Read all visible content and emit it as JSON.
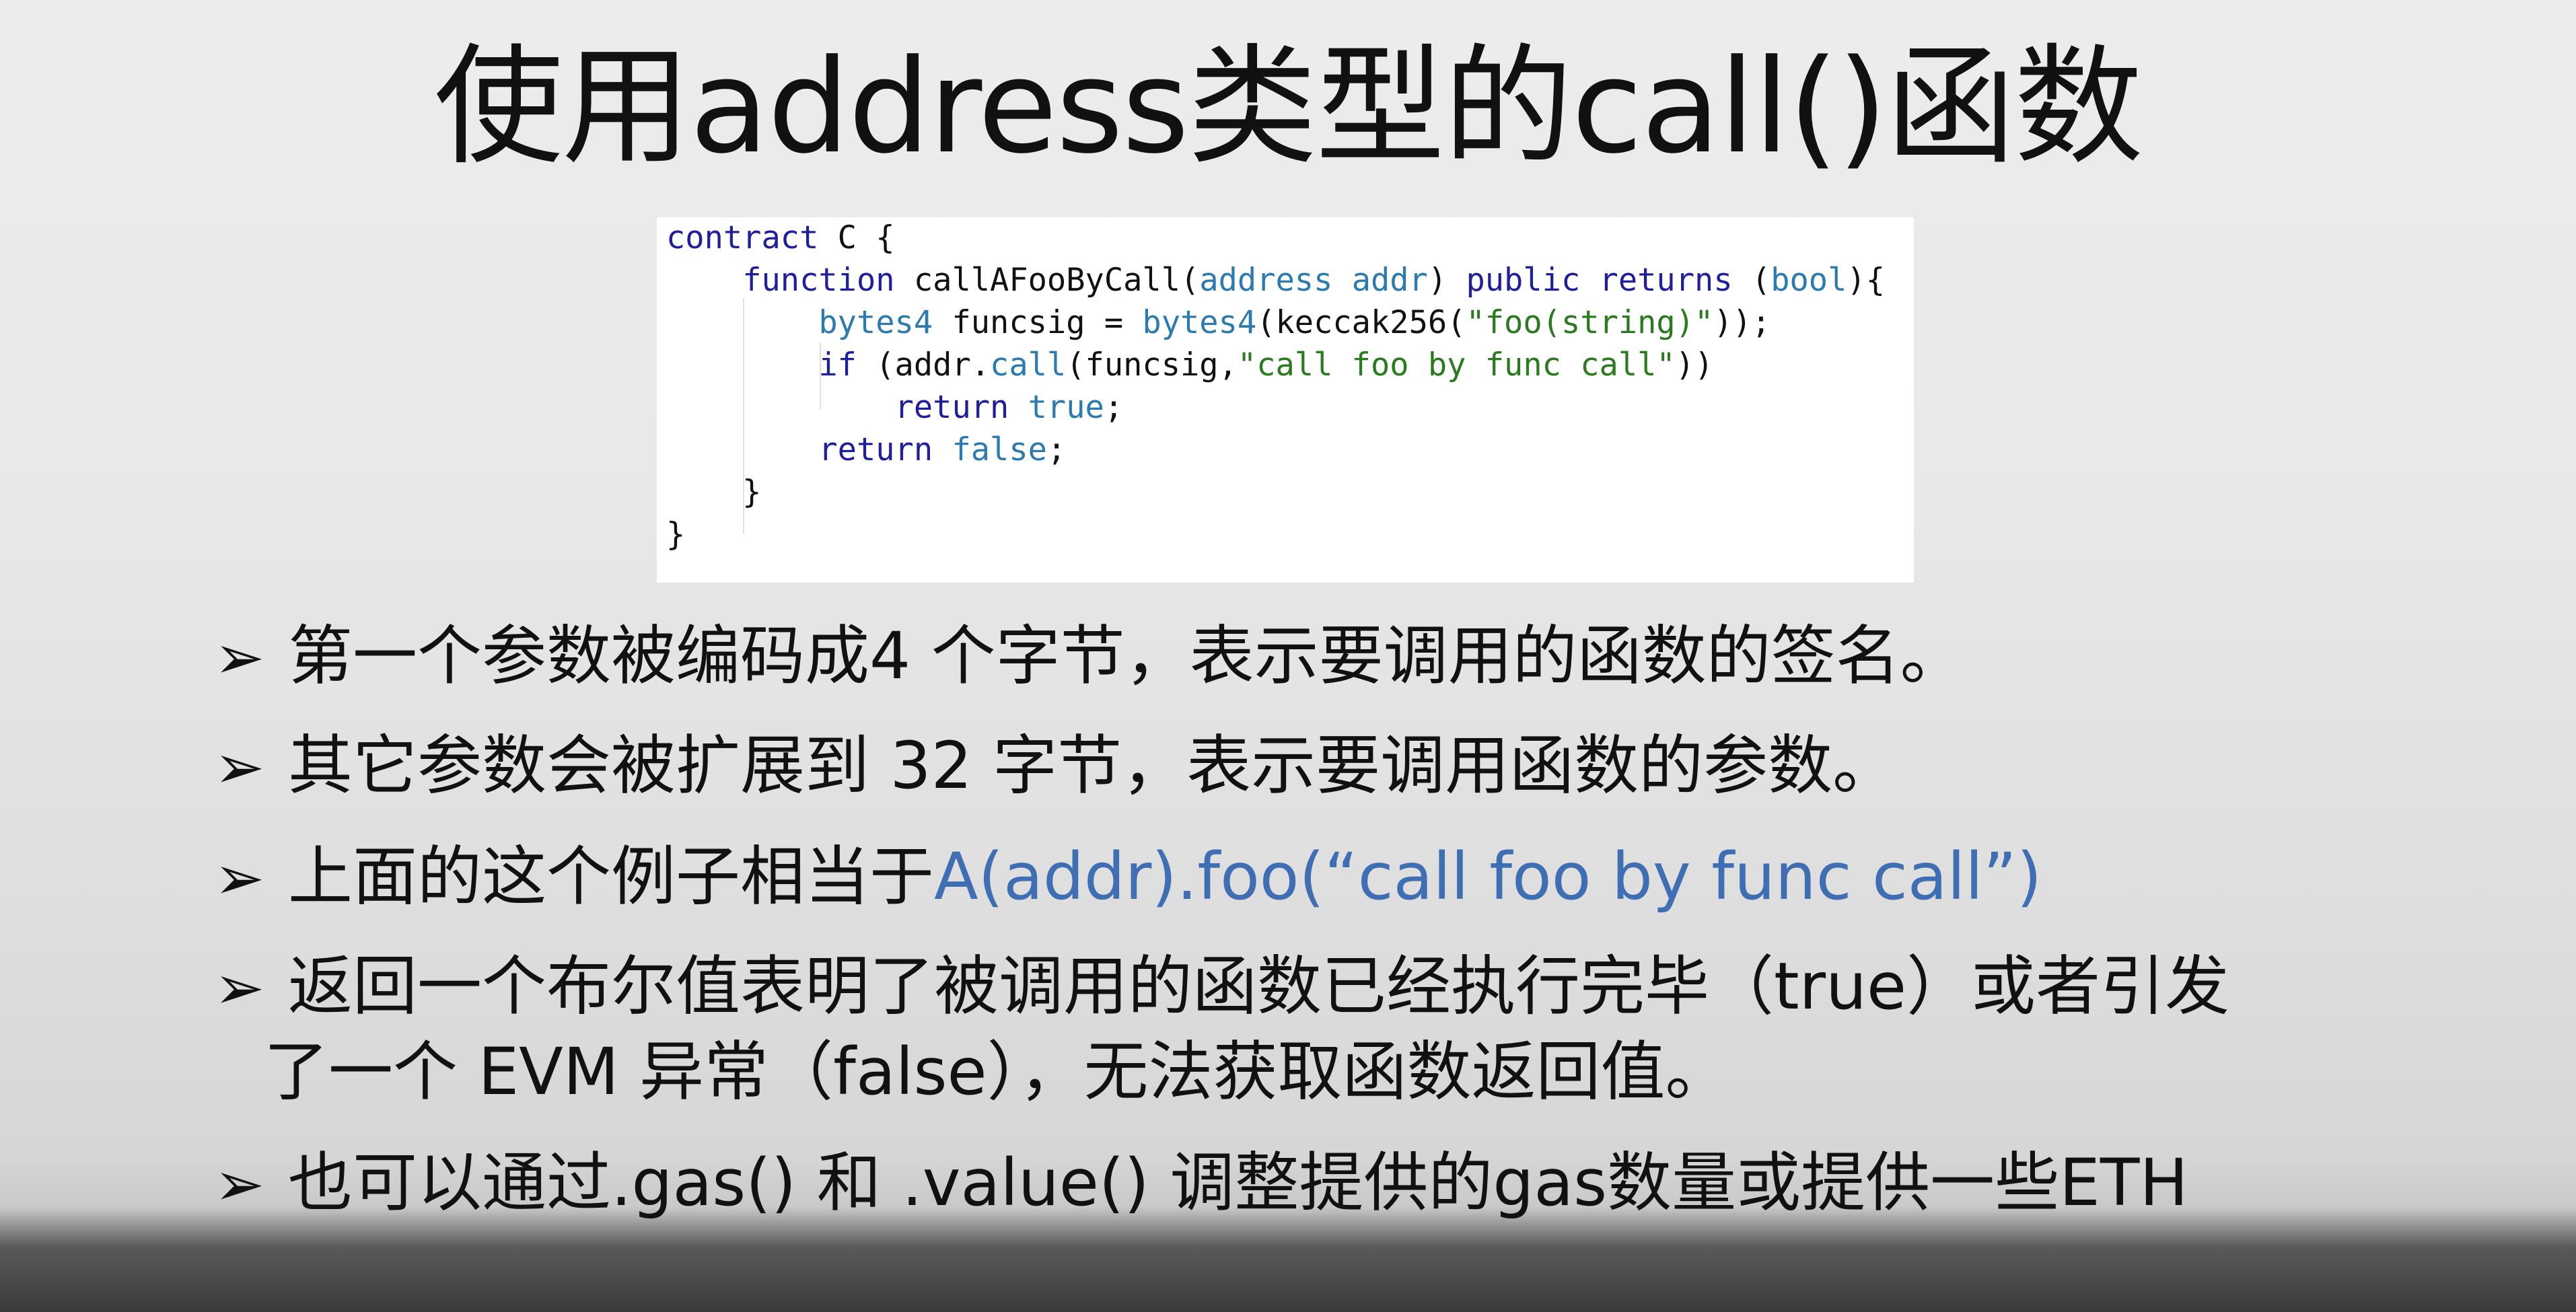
{
  "title": "使用address类型的call()函数",
  "code": {
    "line1": [
      {
        "t": "contract",
        "c": "kw"
      },
      {
        "t": " C {",
        "c": "pl"
      }
    ],
    "line2": [
      {
        "t": "    ",
        "c": "pl"
      },
      {
        "t": "function",
        "c": "kw"
      },
      {
        "t": " callAFooByCall(",
        "c": "pl"
      },
      {
        "t": "address",
        "c": "ty"
      },
      {
        "t": " ",
        "c": "pl"
      },
      {
        "t": "addr",
        "c": "ty"
      },
      {
        "t": ") ",
        "c": "pl"
      },
      {
        "t": "public",
        "c": "kw"
      },
      {
        "t": " ",
        "c": "pl"
      },
      {
        "t": "returns",
        "c": "kw"
      },
      {
        "t": " (",
        "c": "pl"
      },
      {
        "t": "bool",
        "c": "ty"
      },
      {
        "t": "){",
        "c": "pl"
      }
    ],
    "line3": [
      {
        "t": "        ",
        "c": "pl"
      },
      {
        "t": "bytes4",
        "c": "ty"
      },
      {
        "t": " funcsig = ",
        "c": "pl"
      },
      {
        "t": "bytes4",
        "c": "ty"
      },
      {
        "t": "(keccak256(",
        "c": "pl"
      },
      {
        "t": "\"foo(string)\"",
        "c": "st"
      },
      {
        "t": "));",
        "c": "pl"
      }
    ],
    "line4": [
      {
        "t": "        ",
        "c": "pl"
      },
      {
        "t": "if",
        "c": "kw"
      },
      {
        "t": " (addr.",
        "c": "pl"
      },
      {
        "t": "call",
        "c": "ty"
      },
      {
        "t": "(funcsig,",
        "c": "pl"
      },
      {
        "t": "\"call foo by func call\"",
        "c": "st"
      },
      {
        "t": "))",
        "c": "pl"
      }
    ],
    "line5": [
      {
        "t": "            ",
        "c": "pl"
      },
      {
        "t": "return",
        "c": "kw"
      },
      {
        "t": " ",
        "c": "pl"
      },
      {
        "t": "true",
        "c": "ty"
      },
      {
        "t": ";",
        "c": "pl"
      }
    ],
    "line6": [
      {
        "t": "        ",
        "c": "pl"
      },
      {
        "t": "return",
        "c": "kw"
      },
      {
        "t": " ",
        "c": "pl"
      },
      {
        "t": "false",
        "c": "ty"
      },
      {
        "t": ";",
        "c": "pl"
      }
    ],
    "line7": [
      {
        "t": "    }",
        "c": "pl"
      }
    ],
    "line8": [
      {
        "t": "}",
        "c": "pl"
      }
    ]
  },
  "bullets": {
    "marker": "➢",
    "b1": "第一个参数被编码成4 个字节，表示要调用的函数的签名。",
    "b2": "其它参数会被扩展到 32 字节，表示要调用函数的参数。",
    "b3_prefix": "上面的这个例子相当于",
    "b3_highlight": "A(addr).foo(“call foo by func call”)",
    "b4_line1": "返回一个布尔值表明了被调用的函数已经执行完毕（true）或者引发",
    "b4_line2": "了一个 EVM 异常（false），无法获取函数返回值。",
    "b5": "也可以通过.gas() 和 .value() 调整提供的gas数量或提供一些ETH"
  },
  "colors": {
    "keyword": "#1f1f9e",
    "type": "#2b7bb0",
    "string": "#2a7a1e",
    "highlight": "#3f6fb2"
  }
}
